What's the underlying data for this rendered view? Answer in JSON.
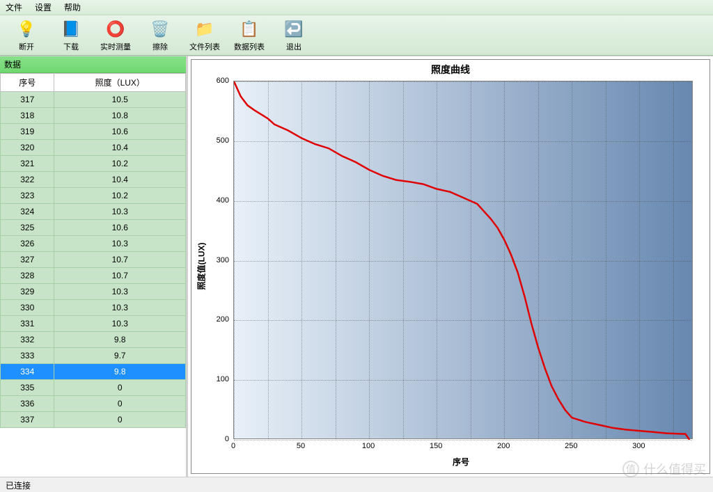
{
  "menu": {
    "file": "文件",
    "settings": "设置",
    "help": "帮助"
  },
  "toolbar": {
    "disconnect": "断开",
    "download": "下载",
    "realtime": "实时测量",
    "erase": "擦除",
    "filelist": "文件列表",
    "datalist": "数据列表",
    "exit": "退出"
  },
  "panel": {
    "title": "数据"
  },
  "table": {
    "col_seq": "序号",
    "col_lux": "照度（LUX）",
    "rows": [
      {
        "seq": "317",
        "lux": "10.5"
      },
      {
        "seq": "318",
        "lux": "10.8"
      },
      {
        "seq": "319",
        "lux": "10.6"
      },
      {
        "seq": "320",
        "lux": "10.4"
      },
      {
        "seq": "321",
        "lux": "10.2"
      },
      {
        "seq": "322",
        "lux": "10.4"
      },
      {
        "seq": "323",
        "lux": "10.2"
      },
      {
        "seq": "324",
        "lux": "10.3"
      },
      {
        "seq": "325",
        "lux": "10.6"
      },
      {
        "seq": "326",
        "lux": "10.3"
      },
      {
        "seq": "327",
        "lux": "10.7"
      },
      {
        "seq": "328",
        "lux": "10.7"
      },
      {
        "seq": "329",
        "lux": "10.3"
      },
      {
        "seq": "330",
        "lux": "10.3"
      },
      {
        "seq": "331",
        "lux": "10.3"
      },
      {
        "seq": "332",
        "lux": "9.8"
      },
      {
        "seq": "333",
        "lux": "9.7"
      },
      {
        "seq": "334",
        "lux": "9.8",
        "selected": true
      },
      {
        "seq": "335",
        "lux": "0"
      },
      {
        "seq": "336",
        "lux": "0"
      },
      {
        "seq": "337",
        "lux": "0"
      }
    ]
  },
  "status": {
    "text": "已连接"
  },
  "watermark": {
    "text": "什么值得买"
  },
  "chart_data": {
    "type": "line",
    "title": "照度曲线",
    "xlabel": "序号",
    "ylabel": "照度值(LUX)",
    "xlim": [
      0,
      340
    ],
    "ylim": [
      0,
      600
    ],
    "xticks": [
      0,
      50,
      100,
      150,
      200,
      250,
      300
    ],
    "yticks": [
      0,
      100,
      200,
      300,
      400,
      500,
      600
    ],
    "series": [
      {
        "name": "照度",
        "color": "#e00000",
        "x": [
          0,
          5,
          10,
          15,
          20,
          25,
          30,
          40,
          50,
          60,
          70,
          80,
          90,
          100,
          110,
          120,
          130,
          140,
          150,
          160,
          170,
          180,
          190,
          195,
          200,
          205,
          210,
          215,
          220,
          225,
          230,
          235,
          240,
          245,
          250,
          260,
          270,
          280,
          290,
          300,
          310,
          320,
          330,
          334,
          337
        ],
        "y": [
          600,
          575,
          560,
          552,
          545,
          538,
          528,
          518,
          505,
          495,
          488,
          475,
          465,
          452,
          442,
          435,
          432,
          428,
          420,
          415,
          405,
          395,
          370,
          355,
          335,
          310,
          280,
          240,
          195,
          155,
          120,
          90,
          68,
          50,
          37,
          30,
          25,
          20,
          17,
          15,
          13,
          11,
          10,
          9.8,
          0
        ]
      }
    ]
  }
}
